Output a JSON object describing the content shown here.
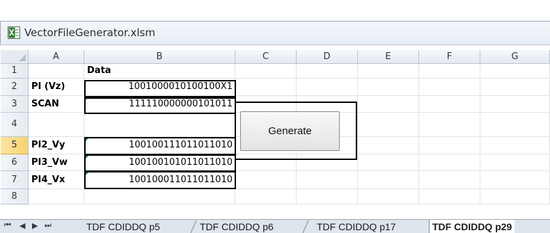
{
  "window": {
    "title": "VectorFileGenerator.xlsm",
    "icon": "excel-icon"
  },
  "columns": [
    "A",
    "B",
    "C",
    "D",
    "E",
    "F",
    "G"
  ],
  "rows": [
    {
      "num": "1",
      "a": "",
      "b": "Data",
      "selected": false
    },
    {
      "num": "2",
      "a": "PI (Vz)",
      "b": "1001000010100100X1",
      "selected": false
    },
    {
      "num": "3",
      "a": "SCAN",
      "b": "111110000000101011",
      "selected": false
    },
    {
      "num": "4",
      "a": "",
      "b": "",
      "selected": false
    },
    {
      "num": "5",
      "a": "PI2_Vy",
      "b": "100100111011011010",
      "selected": true
    },
    {
      "num": "6",
      "a": "PI3_Vw",
      "b": "100100101011011010",
      "selected": false
    },
    {
      "num": "7",
      "a": "PI4_Vx",
      "b": "100100011011011010",
      "selected": false
    },
    {
      "num": "8",
      "a": "",
      "b": "",
      "selected": false
    }
  ],
  "button": {
    "label": "Generate"
  },
  "sheet_tabs": [
    {
      "label": "TDF CDIDDQ p5",
      "active": false
    },
    {
      "label": "TDF CDIDDQ p6",
      "active": false
    },
    {
      "label": "TDF CDIDDQ p17",
      "active": false
    },
    {
      "label": "TDF CDIDDQ p29",
      "active": true
    }
  ],
  "nav_buttons": [
    "first-sheet",
    "prev-sheet",
    "next-sheet",
    "last-sheet"
  ],
  "colors": {
    "selected_row_header": "#f6d370",
    "error_triangle": "#1f8f3d"
  }
}
